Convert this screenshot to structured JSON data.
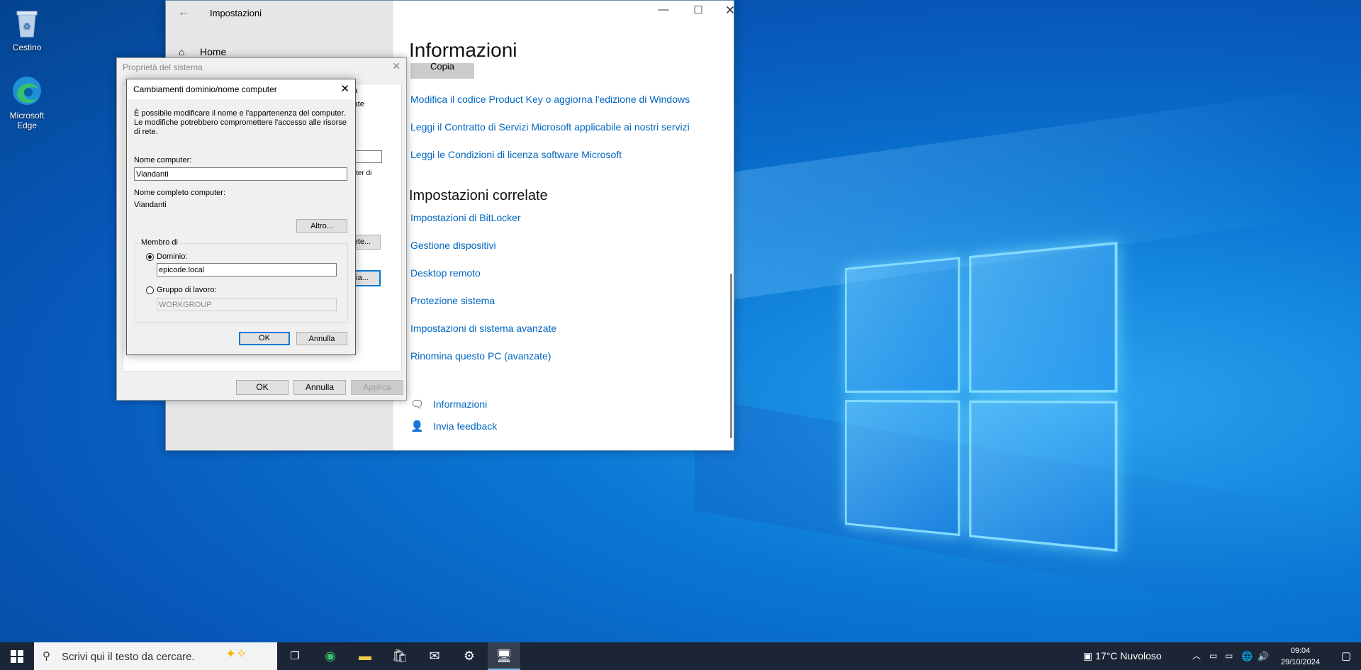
{
  "desktop": {
    "icons": [
      {
        "label": "Cestino",
        "icon": "recycle-bin-icon"
      },
      {
        "label": "Microsoft Edge",
        "icon": "edge-icon"
      }
    ]
  },
  "settings": {
    "title": "Impostazioni",
    "nav_home": "Home",
    "heading": "Informazioni",
    "copy_button": "Copia",
    "links": [
      "Modifica il codice Product Key o aggiorna l'edizione di Windows",
      "Leggi il Contratto di Servizi Microsoft applicabile ai nostri servizi",
      "Leggi le Condizioni di licenza software Microsoft"
    ],
    "related_heading": "Impostazioni correlate",
    "related_links": [
      "Impostazioni di BitLocker",
      "Gestione dispositivi",
      "Desktop remoto",
      "Protezione sistema",
      "Impostazioni di sistema avanzate",
      "Rinomina questo PC (avanzate)"
    ],
    "help_links": [
      "Informazioni",
      "Invia feedback"
    ]
  },
  "system_properties": {
    "title": "Proprietà del sistema",
    "tab_partial_1": "ota",
    "tab_partial_2": "nzate",
    "text_partial": "puter di",
    "button_partial_1": "ete...",
    "button_partial_2": "ia...",
    "ok": "OK",
    "cancel": "Annulla",
    "apply": "Applica"
  },
  "domain_dialog": {
    "title": "Cambiamenti dominio/nome computer",
    "description": "È possibile modificare il nome e l'appartenenza del computer. Le modifiche potrebbero compromettere l'accesso alle risorse di rete.",
    "computer_name_label": "Nome computer:",
    "computer_name_value": "Viandanti",
    "full_name_label": "Nome completo computer:",
    "full_name_value": "Viandanti",
    "more_button": "Altro...",
    "member_of_label": "Membro di",
    "domain_label": "Dominio:",
    "domain_value": "epicode.local",
    "workgroup_label": "Gruppo di lavoro:",
    "workgroup_value": "WORKGROUP",
    "domain_selected": true,
    "ok": "OK",
    "cancel": "Annulla"
  },
  "taskbar": {
    "search_placeholder": "Scrivi qui il testo da cercare.",
    "weather": "17°C  Nuvoloso",
    "time": "09:04",
    "date": "29/10/2024"
  }
}
